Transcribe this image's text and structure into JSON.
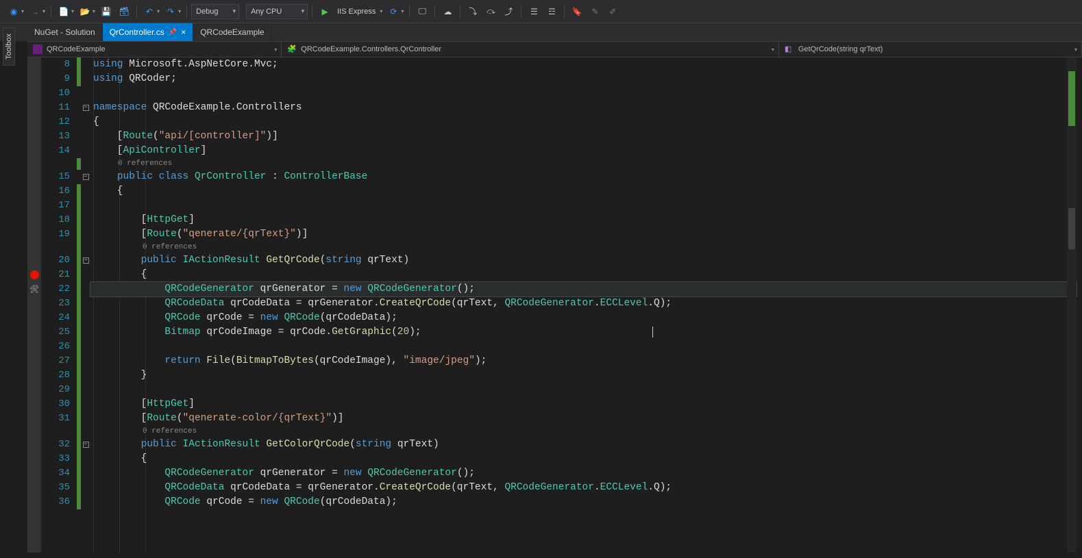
{
  "toolbar": {
    "config": "Debug",
    "platform": "Any CPU",
    "run_label": "IIS Express"
  },
  "toolbox_label": "Toolbox",
  "tabs": [
    {
      "label": "NuGet - Solution",
      "active": false
    },
    {
      "label": "QrController.cs",
      "active": true,
      "pinned": true
    },
    {
      "label": "QRCodeExample",
      "active": false
    }
  ],
  "nav": {
    "project": "QRCodeExample",
    "class": "QRCodeExample.Controllers.QrController",
    "member": "GetQrCode(string qrText)"
  },
  "refs_label": "0 references",
  "breakpoint_line": 21,
  "current_line": 22,
  "first_line_number": 8,
  "code_lines": [
    {
      "n": 8,
      "seg": [
        [
          "kw",
          "using"
        ],
        [
          "plain",
          " Microsoft.AspNetCore.Mvc;"
        ]
      ]
    },
    {
      "n": 9,
      "seg": [
        [
          "kw",
          "using"
        ],
        [
          "plain",
          " QRCoder;"
        ]
      ]
    },
    {
      "n": 10,
      "seg": []
    },
    {
      "n": 11,
      "fold": "-",
      "seg": [
        [
          "kw",
          "namespace"
        ],
        [
          "plain",
          " QRCodeExample.Controllers"
        ]
      ]
    },
    {
      "n": 12,
      "seg": [
        [
          "plain",
          "{"
        ]
      ]
    },
    {
      "n": 13,
      "seg": [
        [
          "plain",
          "    ["
        ],
        [
          "type",
          "Route"
        ],
        [
          "plain",
          "("
        ],
        [
          "str",
          "\"api/[controller]\""
        ],
        [
          "plain",
          ")]"
        ]
      ]
    },
    {
      "n": 14,
      "seg": [
        [
          "plain",
          "    ["
        ],
        [
          "type",
          "ApiController"
        ],
        [
          "plain",
          "]"
        ]
      ]
    },
    {
      "ref": true
    },
    {
      "n": 15,
      "fold": "-",
      "seg": [
        [
          "plain",
          "    "
        ],
        [
          "kw",
          "public"
        ],
        [
          "plain",
          " "
        ],
        [
          "kw",
          "class"
        ],
        [
          "plain",
          " "
        ],
        [
          "type",
          "QrController"
        ],
        [
          "plain",
          " : "
        ],
        [
          "type",
          "ControllerBase"
        ]
      ]
    },
    {
      "n": 16,
      "seg": [
        [
          "plain",
          "    {"
        ]
      ]
    },
    {
      "n": 17,
      "seg": []
    },
    {
      "n": 18,
      "seg": [
        [
          "plain",
          "        ["
        ],
        [
          "type",
          "HttpGet"
        ],
        [
          "plain",
          "]"
        ]
      ]
    },
    {
      "n": 19,
      "seg": [
        [
          "plain",
          "        ["
        ],
        [
          "type",
          "Route"
        ],
        [
          "plain",
          "("
        ],
        [
          "str",
          "\"qenerate/{qrText}\""
        ],
        [
          "plain",
          ")]"
        ]
      ]
    },
    {
      "ref": true,
      "indent": 8
    },
    {
      "n": 20,
      "fold": "-",
      "seg": [
        [
          "plain",
          "        "
        ],
        [
          "kw",
          "public"
        ],
        [
          "plain",
          " "
        ],
        [
          "type",
          "IActionResult"
        ],
        [
          "plain",
          " "
        ],
        [
          "mtd",
          "GetQrCode"
        ],
        [
          "plain",
          "("
        ],
        [
          "kw",
          "string"
        ],
        [
          "plain",
          " qrText)"
        ]
      ]
    },
    {
      "n": 21,
      "bp": true,
      "seg": [
        [
          "plain",
          "        {"
        ]
      ]
    },
    {
      "n": 22,
      "current": true,
      "screw": true,
      "seg": [
        [
          "plain",
          "            "
        ],
        [
          "type",
          "QRCodeGenerator"
        ],
        [
          "plain",
          " qrGenerator = "
        ],
        [
          "kw",
          "new"
        ],
        [
          "plain",
          " "
        ],
        [
          "type",
          "QRCodeGenerator"
        ],
        [
          "plain",
          "();"
        ]
      ]
    },
    {
      "n": 23,
      "seg": [
        [
          "plain",
          "            "
        ],
        [
          "type",
          "QRCodeData"
        ],
        [
          "plain",
          " qrCodeData = qrGenerator."
        ],
        [
          "mtd",
          "CreateQrCode"
        ],
        [
          "plain",
          "(qrText, "
        ],
        [
          "type",
          "QRCodeGenerator"
        ],
        [
          "plain",
          "."
        ],
        [
          "type",
          "ECCLevel"
        ],
        [
          "plain",
          ".Q);"
        ]
      ]
    },
    {
      "n": 24,
      "seg": [
        [
          "plain",
          "            "
        ],
        [
          "type",
          "QRCode"
        ],
        [
          "plain",
          " qrCode = "
        ],
        [
          "kw",
          "new"
        ],
        [
          "plain",
          " "
        ],
        [
          "type",
          "QRCode"
        ],
        [
          "plain",
          "(qrCodeData);"
        ]
      ]
    },
    {
      "n": 25,
      "seg": [
        [
          "plain",
          "            "
        ],
        [
          "type",
          "Bitmap"
        ],
        [
          "plain",
          " qrCodeImage = qrCode."
        ],
        [
          "mtd",
          "GetGraphic"
        ],
        [
          "plain",
          "("
        ],
        [
          "num",
          "20"
        ],
        [
          "plain",
          ");"
        ]
      ]
    },
    {
      "n": 26,
      "seg": []
    },
    {
      "n": 27,
      "seg": [
        [
          "plain",
          "            "
        ],
        [
          "kw",
          "return"
        ],
        [
          "plain",
          " "
        ],
        [
          "mtd",
          "File"
        ],
        [
          "plain",
          "("
        ],
        [
          "mtd",
          "BitmapToBytes"
        ],
        [
          "plain",
          "(qrCodeImage), "
        ],
        [
          "str",
          "\"image/jpeg\""
        ],
        [
          "plain",
          ");"
        ]
      ]
    },
    {
      "n": 28,
      "seg": [
        [
          "plain",
          "        }"
        ]
      ]
    },
    {
      "n": 29,
      "seg": []
    },
    {
      "n": 30,
      "seg": [
        [
          "plain",
          "        ["
        ],
        [
          "type",
          "HttpGet"
        ],
        [
          "plain",
          "]"
        ]
      ]
    },
    {
      "n": 31,
      "seg": [
        [
          "plain",
          "        ["
        ],
        [
          "type",
          "Route"
        ],
        [
          "plain",
          "("
        ],
        [
          "str",
          "\"qenerate-color/{qrText}\""
        ],
        [
          "plain",
          ")]"
        ]
      ]
    },
    {
      "ref": true,
      "indent": 8
    },
    {
      "n": 32,
      "fold": "-",
      "seg": [
        [
          "plain",
          "        "
        ],
        [
          "kw",
          "public"
        ],
        [
          "plain",
          " "
        ],
        [
          "type",
          "IActionResult"
        ],
        [
          "plain",
          " "
        ],
        [
          "mtd",
          "GetColorQrCode"
        ],
        [
          "plain",
          "("
        ],
        [
          "kw",
          "string"
        ],
        [
          "plain",
          " qrText)"
        ]
      ]
    },
    {
      "n": 33,
      "seg": [
        [
          "plain",
          "        {"
        ]
      ]
    },
    {
      "n": 34,
      "seg": [
        [
          "plain",
          "            "
        ],
        [
          "type",
          "QRCodeGenerator"
        ],
        [
          "plain",
          " qrGenerator = "
        ],
        [
          "kw",
          "new"
        ],
        [
          "plain",
          " "
        ],
        [
          "type",
          "QRCodeGenerator"
        ],
        [
          "plain",
          "();"
        ]
      ]
    },
    {
      "n": 35,
      "seg": [
        [
          "plain",
          "            "
        ],
        [
          "type",
          "QRCodeData"
        ],
        [
          "plain",
          " qrCodeData = qrGenerator."
        ],
        [
          "mtd",
          "CreateQrCode"
        ],
        [
          "plain",
          "(qrText, "
        ],
        [
          "type",
          "QRCodeGenerator"
        ],
        [
          "plain",
          "."
        ],
        [
          "type",
          "ECCLevel"
        ],
        [
          "plain",
          ".Q);"
        ]
      ]
    },
    {
      "n": 36,
      "seg": [
        [
          "plain",
          "            "
        ],
        [
          "type",
          "QRCode"
        ],
        [
          "plain",
          " qrCode = "
        ],
        [
          "kw",
          "new"
        ],
        [
          "plain",
          " "
        ],
        [
          "type",
          "QRCode"
        ],
        [
          "plain",
          "(qrCodeData);"
        ]
      ]
    }
  ]
}
